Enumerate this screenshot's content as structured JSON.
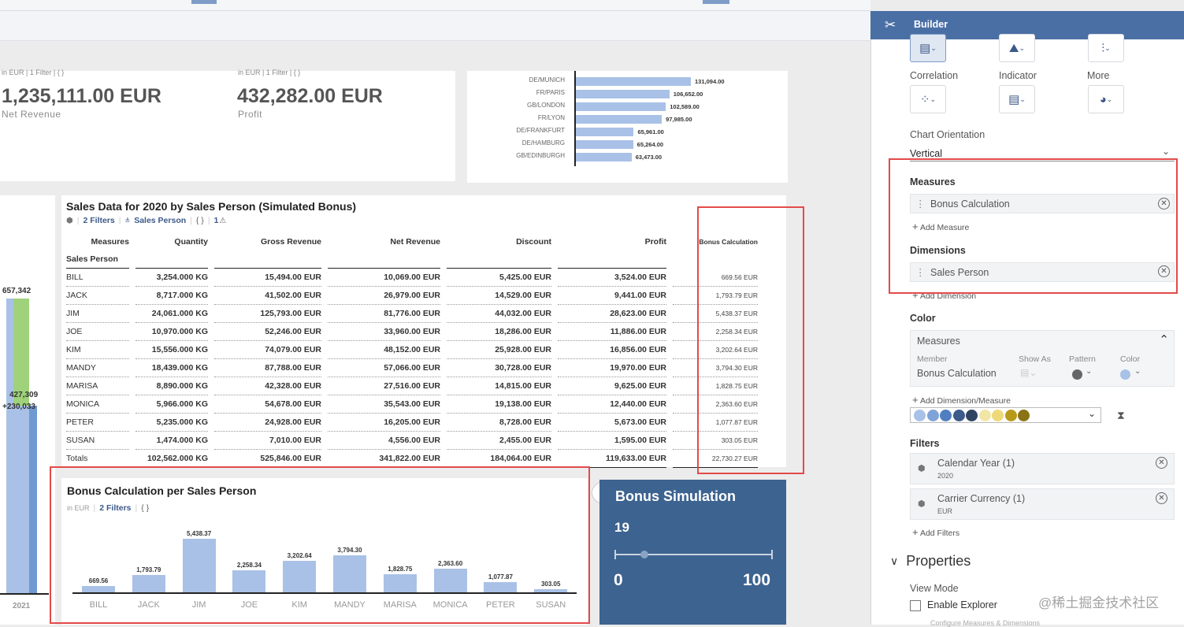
{
  "kpis": [
    {
      "meta": "in EUR | 1 Filter | { }",
      "value": "1,235,111.00 EUR",
      "label": "Net Revenue"
    },
    {
      "meta": "in EUR | 1 Filter | { }",
      "value": "432,282.00 EUR",
      "label": "Profit"
    }
  ],
  "city_chart": {
    "rows": [
      {
        "city": "DE/MUNICH",
        "value": 131094,
        "label": "131,094.00"
      },
      {
        "city": "FR/PARIS",
        "value": 106652,
        "label": "106,652.00"
      },
      {
        "city": "GB/LONDON",
        "value": 102589,
        "label": "102,589.00"
      },
      {
        "city": "FR/LYON",
        "value": 97985,
        "label": "97,985.00"
      },
      {
        "city": "DE/FRANKFURT",
        "value": 65961,
        "label": "65,961.00"
      },
      {
        "city": "DE/HAMBURG",
        "value": 65264,
        "label": "65,264.00"
      },
      {
        "city": "GB/EDINBURGH",
        "value": 63473,
        "label": "63,473.00"
      }
    ]
  },
  "left_chart": {
    "val1": "657,342",
    "val2": "427,309",
    "val3": "+230,033",
    "year": "2021"
  },
  "sales_table": {
    "title": "Sales Data for 2020 by Sales Person (Simulated Bonus)",
    "filters": "2 Filters",
    "dimension": "Sales Person",
    "braces": "{ }",
    "warnings": "1",
    "measures_header": "Measures",
    "row_header": "Sales Person",
    "columns": [
      "Quantity",
      "Gross Revenue",
      "Net Revenue",
      "Discount",
      "Profit",
      "Bonus Calculation"
    ],
    "rows": [
      {
        "name": "BILL",
        "cells": [
          "3,254.000 KG",
          "15,494.00 EUR",
          "10,069.00 EUR",
          "5,425.00 EUR",
          "3,524.00 EUR",
          "669.56 EUR"
        ]
      },
      {
        "name": "JACK",
        "cells": [
          "8,717.000 KG",
          "41,502.00 EUR",
          "26,979.00 EUR",
          "14,529.00 EUR",
          "9,441.00 EUR",
          "1,793.79 EUR"
        ]
      },
      {
        "name": "JIM",
        "cells": [
          "24,061.000 KG",
          "125,793.00 EUR",
          "81,776.00 EUR",
          "44,032.00 EUR",
          "28,623.00 EUR",
          "5,438.37 EUR"
        ]
      },
      {
        "name": "JOE",
        "cells": [
          "10,970.000 KG",
          "52,246.00 EUR",
          "33,960.00 EUR",
          "18,286.00 EUR",
          "11,886.00 EUR",
          "2,258.34 EUR"
        ]
      },
      {
        "name": "KIM",
        "cells": [
          "15,556.000 KG",
          "74,079.00 EUR",
          "48,152.00 EUR",
          "25,928.00 EUR",
          "16,856.00 EUR",
          "3,202.64 EUR"
        ]
      },
      {
        "name": "MANDY",
        "cells": [
          "18,439.000 KG",
          "87,788.00 EUR",
          "57,066.00 EUR",
          "30,728.00 EUR",
          "19,970.00 EUR",
          "3,794.30 EUR"
        ]
      },
      {
        "name": "MARISA",
        "cells": [
          "8,890.000 KG",
          "42,328.00 EUR",
          "27,516.00 EUR",
          "14,815.00 EUR",
          "9,625.00 EUR",
          "1,828.75 EUR"
        ]
      },
      {
        "name": "MONICA",
        "cells": [
          "5,966.000 KG",
          "54,678.00 EUR",
          "35,543.00 EUR",
          "19,138.00 EUR",
          "12,440.00 EUR",
          "2,363.60 EUR"
        ]
      },
      {
        "name": "PETER",
        "cells": [
          "5,235.000 KG",
          "24,928.00 EUR",
          "16,205.00 EUR",
          "8,728.00 EUR",
          "5,673.00 EUR",
          "1,077.87 EUR"
        ]
      },
      {
        "name": "SUSAN",
        "cells": [
          "1,474.000 KG",
          "7,010.00 EUR",
          "4,556.00 EUR",
          "2,455.00 EUR",
          "1,595.00 EUR",
          "303.05 EUR"
        ]
      },
      {
        "name": "Totals",
        "cells": [
          "102,562.000 KG",
          "525,846.00 EUR",
          "341,822.00 EUR",
          "184,064.00 EUR",
          "119,633.00 EUR",
          "22,730.27 EUR"
        ]
      }
    ]
  },
  "bonus_chart": {
    "title": "Bonus Calculation per Sales Person",
    "unit": "in EUR",
    "filters": "2 Filters",
    "braces": "{ }"
  },
  "chart_data": {
    "type": "bar",
    "title": "Bonus Calculation per Sales Person",
    "categories": [
      "BILL",
      "JACK",
      "JIM",
      "JOE",
      "KIM",
      "MANDY",
      "MARISA",
      "MONICA",
      "PETER",
      "SUSAN"
    ],
    "values": [
      669.56,
      1793.79,
      5438.37,
      2258.34,
      3202.64,
      3794.3,
      1828.75,
      2363.6,
      1077.87,
      303.05
    ],
    "labels": [
      "669.56",
      "1,793.79",
      "5,438.37",
      "2,258.34",
      "3,202.64",
      "3,794.30",
      "1,828.75",
      "2,363.60",
      "1,077.87",
      "303.05"
    ],
    "ylim": [
      0,
      5438.37
    ]
  },
  "simulation": {
    "title": "Bonus Simulation",
    "value": "19",
    "min": "0",
    "max": "100",
    "level_percent": 19,
    "more": "•••"
  },
  "builder": {
    "title": "Builder",
    "row1": [
      "",
      "",
      ""
    ],
    "row2": [
      "Correlation",
      "Indicator",
      "More"
    ],
    "orientation_label": "Chart Orientation",
    "orientation_value": "Vertical",
    "measures_title": "Measures",
    "measure_item": "Bonus Calculation",
    "add_measure": "Add Measure",
    "dimensions_title": "Dimensions",
    "dimension_item": "Sales Person",
    "add_dimension": "Add Dimension",
    "color_title": "Color",
    "color_box_title": "Measures",
    "member_header": "Member",
    "show_as_header": "Show As",
    "pattern_header": "Pattern",
    "color_header": "Color",
    "member_value": "Bonus Calculation",
    "add_dim_measure": "Add Dimension/Measure",
    "palette": [
      "#a9c1e6",
      "#7fa3d8",
      "#4f7fc0",
      "#3d5a8a",
      "#2f4460",
      "#f2e6a6",
      "#eed97a",
      "#b89a1a",
      "#8a7316"
    ],
    "filters_title": "Filters",
    "filters": [
      {
        "name": "Calendar Year (1)",
        "value": "2020"
      },
      {
        "name": "Carrier Currency (1)",
        "value": "EUR"
      }
    ],
    "add_filters": "Add Filters",
    "properties": "Properties",
    "view_mode": "View Mode",
    "enable_explorer": "Enable Explorer",
    "configure": "Configure Measures & Dimensions"
  },
  "watermark": "@稀土掘金技术社区"
}
